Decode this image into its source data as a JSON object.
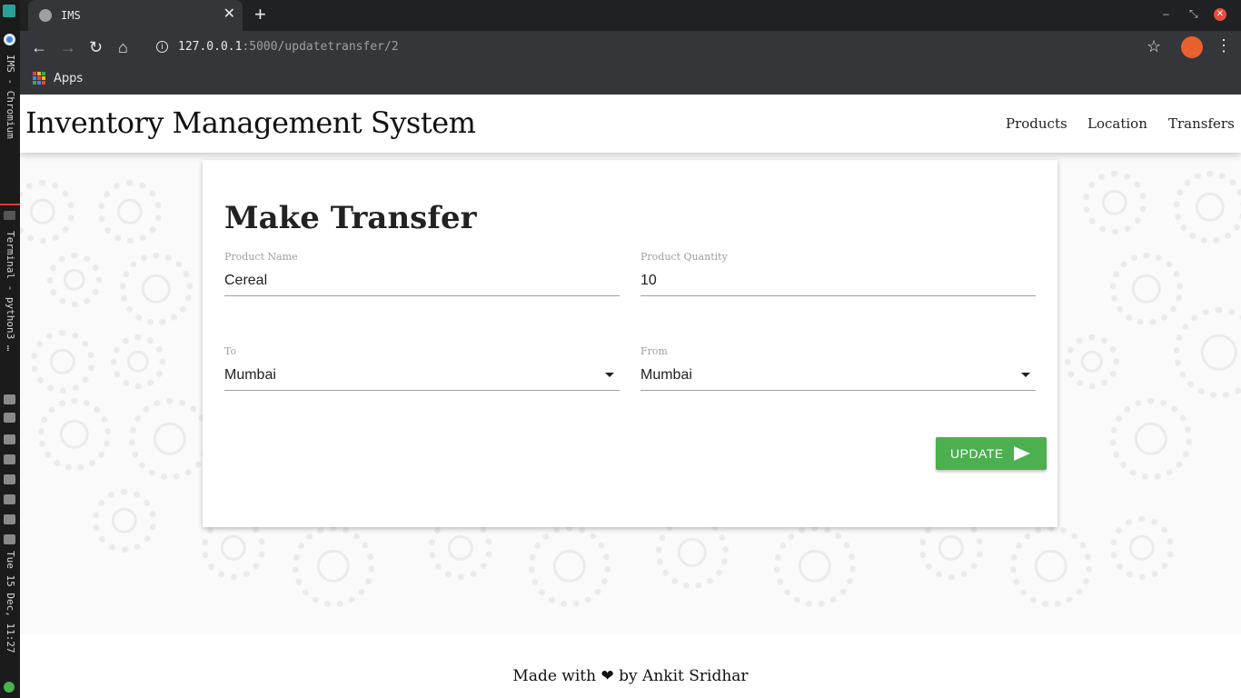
{
  "taskbar": {
    "window1": "IMS - Chromium",
    "window2": "Terminal - python3 …",
    "clock": "Tue 15 Dec, 11:27"
  },
  "browser": {
    "tab_title": "IMS",
    "url_host": "127.0.0.1",
    "url_rest": ":5000/updatetransfer/2",
    "bookmarks_apps": "Apps"
  },
  "nav": {
    "brand": "Inventory Management System",
    "links": [
      "Products",
      "Location",
      "Transfers"
    ]
  },
  "form": {
    "title": "Make Transfer",
    "product_name_label": "Product Name",
    "product_name_value": "Cereal",
    "product_quantity_label": "Product Quantity",
    "product_quantity_value": "10",
    "to_label": "To",
    "to_value": "Mumbai",
    "from_label": "From",
    "from_value": "Mumbai",
    "submit_label": "UPDATE"
  },
  "footer": {
    "prefix": "Made with",
    "heart": "❤",
    "suffix": "by Ankit Sridhar"
  },
  "colors": {
    "accent": "#4caf50",
    "chrome_dark": "#202124",
    "toolbar": "#35363a",
    "close_red": "#e74c3c"
  }
}
